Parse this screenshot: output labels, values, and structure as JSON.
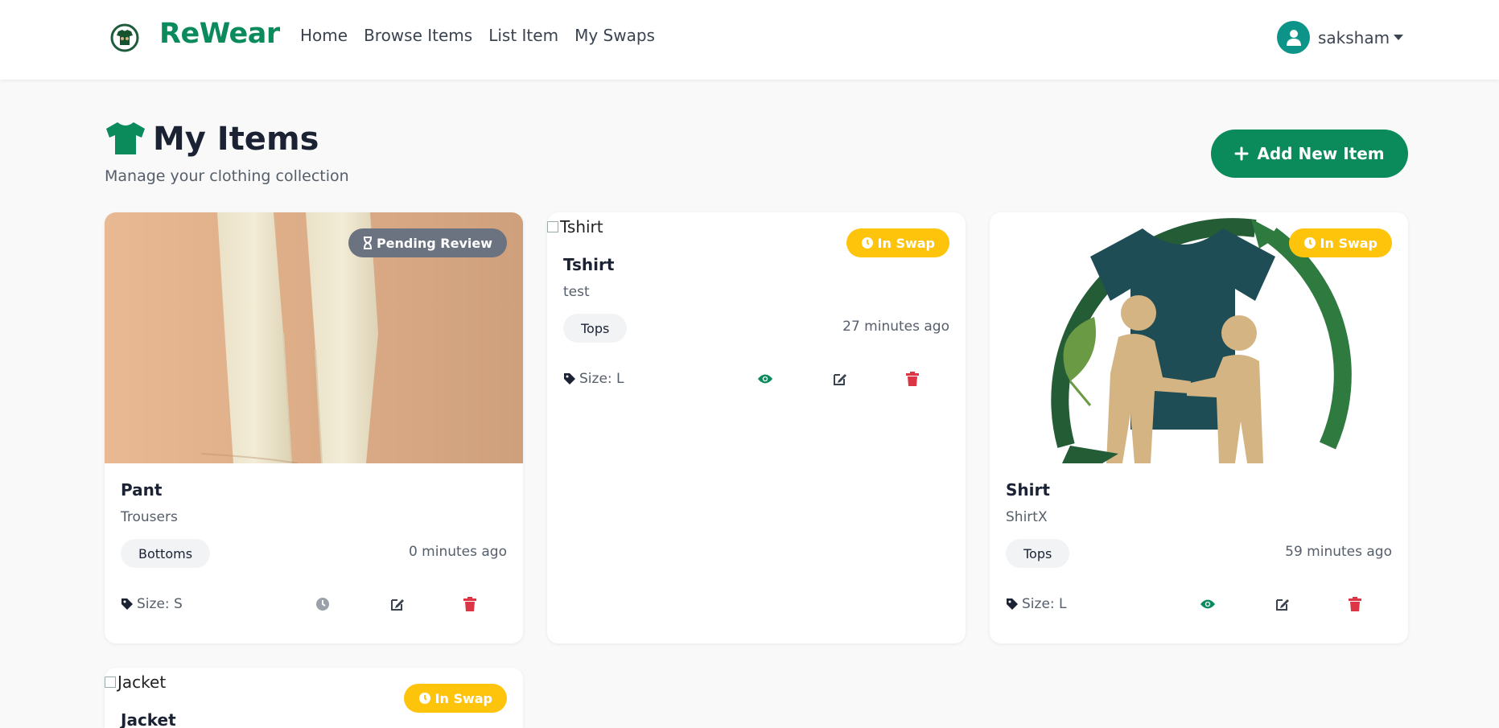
{
  "nav": {
    "brand": "ReWear",
    "links": [
      "Home",
      "Browse Items",
      "List Item",
      "My Swaps"
    ],
    "user": "saksham"
  },
  "header": {
    "title": "My Items",
    "subtitle": "Manage your clothing collection",
    "add_button": "Add New Item"
  },
  "items": [
    {
      "title": "Pant",
      "description": "Trousers",
      "category": "Bottoms",
      "time": "0 minutes ago",
      "size": "Size: S",
      "status": "Pending Review",
      "image_alt": ""
    },
    {
      "title": "Tshirt",
      "description": "test",
      "category": "Tops",
      "time": "27 minutes ago",
      "size": "Size: L",
      "status": "In Swap",
      "image_alt": "Tshirt"
    },
    {
      "title": "Shirt",
      "description": "ShirtX",
      "category": "Tops",
      "time": "59 minutes ago",
      "size": "Size: L",
      "status": "In Swap",
      "image_alt": ""
    },
    {
      "title": "Jacket",
      "status": "In Swap",
      "image_alt": "Jacket"
    }
  ],
  "colors": {
    "brand": "#0b8a5b",
    "pending": "#6b7280",
    "swap": "#fdc40b",
    "delete": "#dc3545"
  },
  "icons": [
    "clock-icon",
    "eye-icon",
    "edit-icon",
    "trash-icon",
    "tag-icon",
    "hourglass-icon",
    "plus-icon"
  ]
}
